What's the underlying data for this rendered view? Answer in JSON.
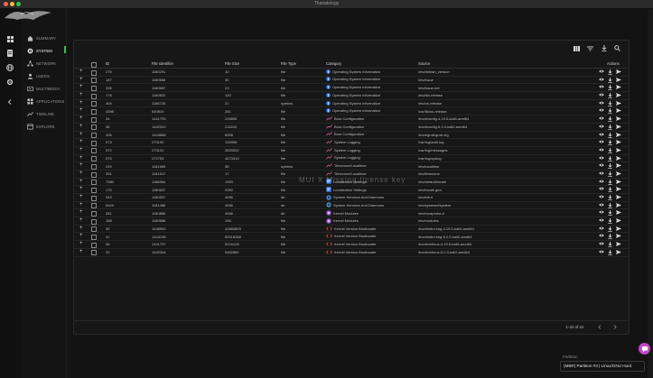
{
  "window": {
    "title": "Thanatology"
  },
  "colors": {
    "accent_green": "#3cba4a",
    "info_blue": "#3b82f6",
    "pink": "#c048c8"
  },
  "sidebar": {
    "items": [
      {
        "label": "SUMMARY",
        "icon": "home-icon"
      },
      {
        "label": "SYSTEM",
        "icon": "gear-icon",
        "active": true
      },
      {
        "label": "NETWORK",
        "icon": "network-icon"
      },
      {
        "label": "USERS",
        "icon": "users-icon"
      },
      {
        "label": "MULTIMEDIA",
        "icon": "media-icon"
      },
      {
        "label": "APPLICATIONS",
        "icon": "apps-icon"
      },
      {
        "label": "TIMELINE",
        "icon": "timeline-icon"
      },
      {
        "label": "EXPLORE",
        "icon": "explore-icon"
      }
    ]
  },
  "table": {
    "columns": {
      "id": "ID",
      "file_identifier": "File Identifier",
      "file_size": "File Size",
      "file_type": "File Type",
      "category": "Category",
      "source": "Source",
      "actions": "Actions"
    },
    "rows": [
      {
        "id": "275",
        "fid": "1180291",
        "size": "10",
        "type": "file",
        "category": "Operating System Information",
        "cat_icon": "info",
        "source": "/etc/debian_version"
      },
      {
        "id": "167",
        "fid": "1180666",
        "size": "30",
        "type": "file",
        "category": "Operating System Information",
        "cat_icon": "info",
        "source": "/etc/issue"
      },
      {
        "id": "335",
        "fid": "1180667",
        "size": "23",
        "type": "file",
        "category": "Operating System Information",
        "cat_icon": "info",
        "source": "/etc/issue.net"
      },
      {
        "id": "178",
        "fid": "1180822",
        "size": "120",
        "type": "file",
        "category": "Operating System Information",
        "cat_icon": "info",
        "source": "/etc/lsb-release"
      },
      {
        "id": "404",
        "fid": "1186725",
        "size": "21",
        "type": "symlink",
        "category": "Operating System Information",
        "cat_icon": "info",
        "source": "/etc/os-release"
      },
      {
        "id": "4398",
        "fid": "540819",
        "size": "281",
        "type": "file",
        "category": "Operating System Information",
        "cat_icon": "info",
        "source": "/usr/lib/os-release"
      },
      {
        "id": "34",
        "fid": "1441795",
        "size": "205806",
        "type": "file",
        "category": "Boot Configuration",
        "cat_icon": "trend",
        "source": "/boot/config-4.19.0-kali4-amd64"
      },
      {
        "id": "36",
        "fid": "1442342",
        "size": "216220",
        "type": "file",
        "category": "Boot Configuration",
        "cat_icon": "trend",
        "source": "/boot/config-5.2.0-kali2-amd64"
      },
      {
        "id": "426",
        "fid": "1444868",
        "size": "8258",
        "type": "file",
        "category": "Boot Configuration",
        "cat_icon": "trend",
        "source": "/boot/grub/grub.cfg"
      },
      {
        "id": "573",
        "fid": "273192",
        "size": "120996",
        "type": "file",
        "category": "System Logging",
        "cat_icon": "trend",
        "source": "/var/log/auth.log"
      },
      {
        "id": "572",
        "fid": "273131",
        "size": "3533202",
        "type": "file",
        "category": "System Logging",
        "cat_icon": "trend",
        "source": "/var/log/messages"
      },
      {
        "id": "575",
        "fid": "272753",
        "size": "4673410",
        "type": "file",
        "category": "System Logging",
        "cat_icon": "trend",
        "source": "/var/log/syslog"
      },
      {
        "id": "249",
        "fid": "1181569",
        "size": "36",
        "type": "symlink",
        "category": "Timezone/Localtime",
        "cat_icon": "trend",
        "source": "/etc/localtime"
      },
      {
        "id": "391",
        "fid": "1181517",
        "size": "17",
        "type": "file",
        "category": "Timezone/Localtime",
        "cat_icon": "trend",
        "source": "/etc/timezone"
      },
      {
        "id": "7080",
        "fid": "1186964",
        "size": "1990",
        "type": "file",
        "category": "Localization Settings",
        "cat_icon": "locale",
        "source": "/etc/default/locale"
      },
      {
        "id": "175",
        "fid": "1180637",
        "size": "9250",
        "type": "file",
        "category": "Localization Settings",
        "cat_icon": "locale",
        "source": "/etc/locale.gen"
      },
      {
        "id": "343",
        "fid": "1180507",
        "size": "4096",
        "type": "dir",
        "category": "System Services And Daemons",
        "cat_icon": "gear",
        "source": "/etc/init.d"
      },
      {
        "id": "6929",
        "fid": "1181486",
        "size": "4096",
        "type": "dir",
        "category": "System Services And Daemons",
        "cat_icon": "gear",
        "source": "/etc/systemd/system"
      },
      {
        "id": "281",
        "fid": "1180880",
        "size": "4096",
        "type": "dir",
        "category": "Kernel Modules",
        "cat_icon": "module",
        "source": "/etc/modprobe.d"
      },
      {
        "id": "188",
        "fid": "1180886",
        "size": "195",
        "type": "file",
        "category": "Kernel Modules",
        "cat_icon": "module",
        "source": "/etc/modules"
      },
      {
        "id": "35",
        "fid": "1448592",
        "size": "41884893",
        "type": "file",
        "category": "Kernel Version Bootloader",
        "cat_icon": "code",
        "source": "/boot/initrd.img-4.19.0-kali4-amd64"
      },
      {
        "id": "41",
        "fid": "1444136",
        "size": "65316388",
        "type": "file",
        "category": "Kernel Version Bootloader",
        "cat_icon": "code",
        "source": "/boot/initrd.img-5.2.0-kali2-amd64"
      },
      {
        "id": "36",
        "fid": "1441797",
        "size": "5216128",
        "type": "file",
        "category": "Kernel Version Bootloader",
        "cat_icon": "code",
        "source": "/boot/vmlinuz-4.19.0-kali4-amd64"
      },
      {
        "id": "29",
        "fid": "1442344",
        "size": "5482880",
        "type": "file",
        "category": "Kernel Version Bootloader",
        "cat_icon": "code",
        "source": "/boot/vmlinuz-5.2.0-kali2-amd64"
      }
    ]
  },
  "pagination": {
    "text": "1–24 of 24"
  },
  "watermark": "MUI X Missing license key",
  "partition": {
    "label": "Partition",
    "value": "(MBR) Partition #3 | Linux/GNU Hurd"
  }
}
